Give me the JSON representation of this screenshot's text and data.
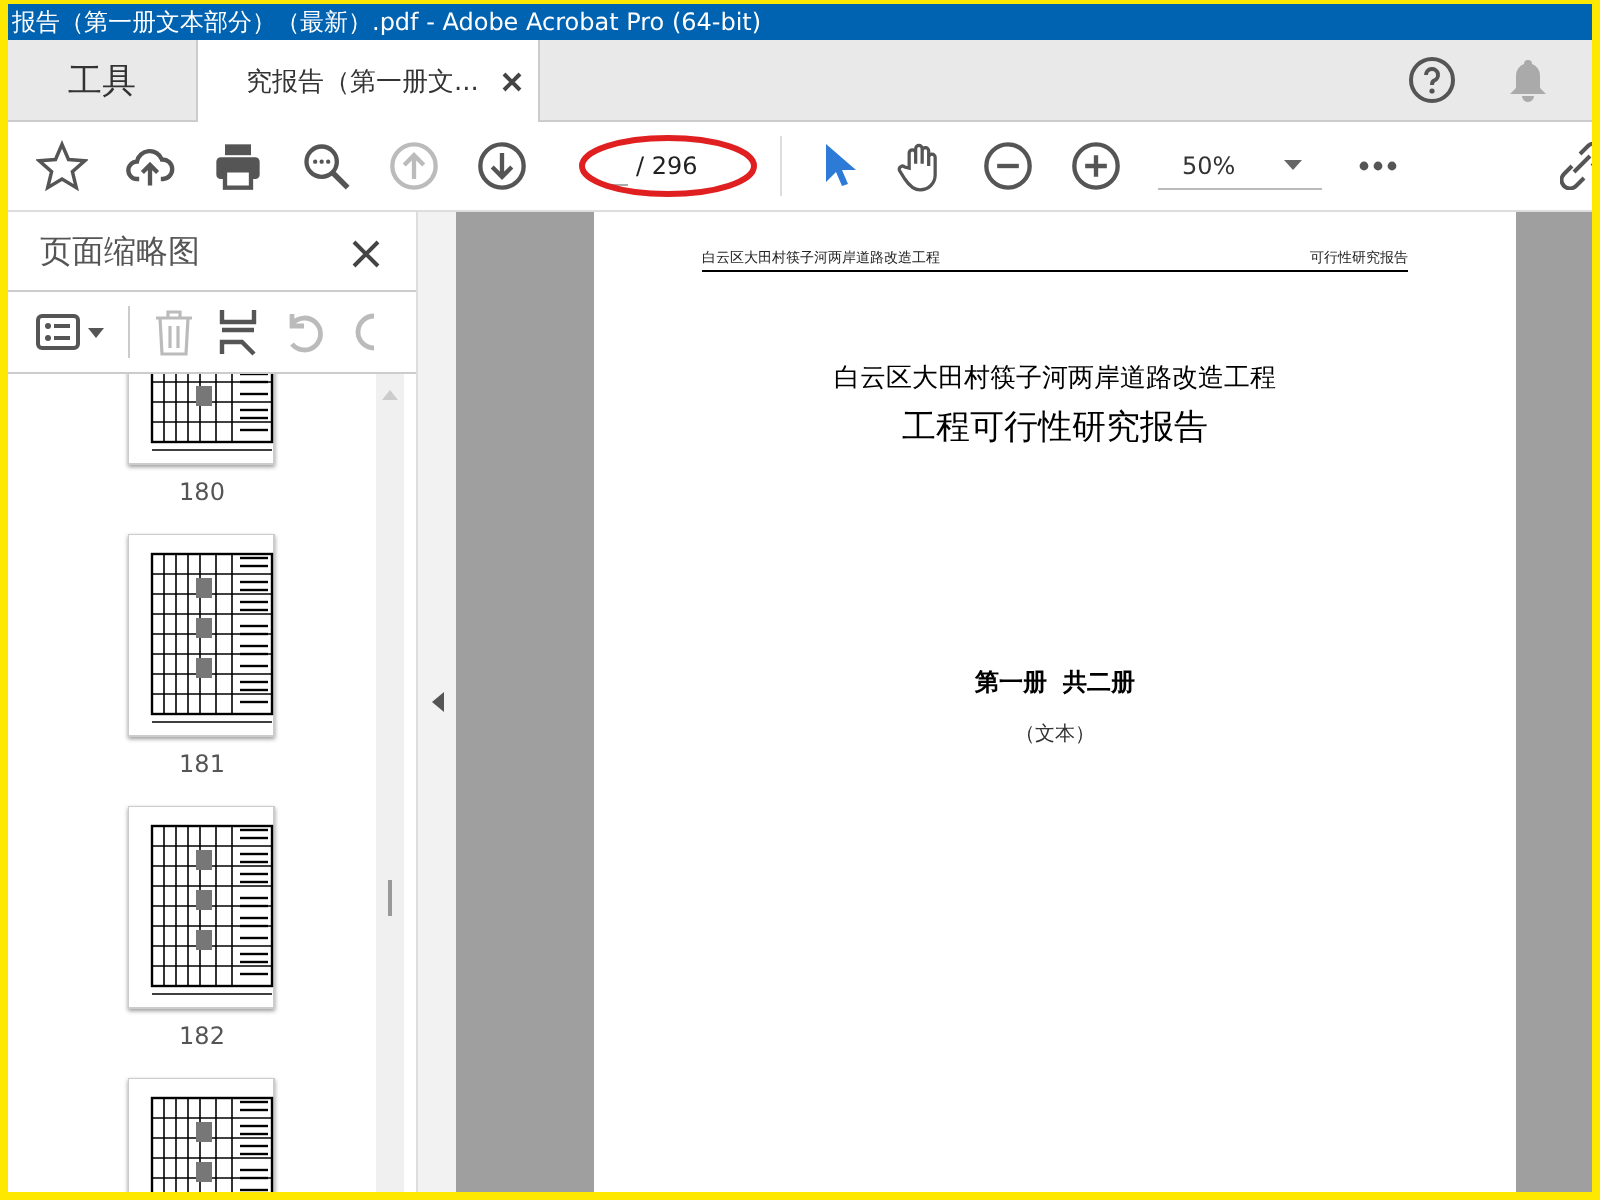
{
  "window": {
    "title": "报告（第一册文本部分）（最新）.pdf - Adobe Acrobat Pro (64-bit)"
  },
  "tabs": [
    {
      "label": "工具",
      "selected": false,
      "closable": false
    },
    {
      "label": "究报告（第一册文...",
      "selected": true,
      "closable": true
    }
  ],
  "toolbar": {
    "tools": [
      {
        "kind": "star",
        "disabled": false
      },
      {
        "kind": "upload",
        "disabled": false
      },
      {
        "kind": "print",
        "disabled": false
      },
      {
        "kind": "search",
        "disabled": false
      },
      {
        "kind": "prev",
        "disabled": true
      },
      {
        "kind": "next",
        "disabled": false
      }
    ],
    "page_total": "/ 296",
    "page_highlighted": true,
    "nav_tools": [
      {
        "kind": "pointer",
        "selected": true
      },
      {
        "kind": "hand",
        "selected": false
      },
      {
        "kind": "zoom-out",
        "selected": false
      },
      {
        "kind": "zoom-in",
        "selected": false
      }
    ],
    "zoom": "50%"
  },
  "sidebar": {
    "title": "页面缩略图",
    "tools": [
      {
        "kind": "options",
        "disabled": false
      },
      {
        "kind": "trash",
        "disabled": true
      },
      {
        "kind": "insert",
        "disabled": false
      },
      {
        "kind": "undo",
        "disabled": true
      },
      {
        "kind": "redo",
        "disabled": true
      }
    ],
    "thumbnails": [
      "180",
      "181",
      "182"
    ],
    "more_below": true
  },
  "document": {
    "header_left": "白云区大田村筷子河两岸道路改造工程",
    "header_right": "可行性研究报告",
    "title_line1": "白云区大田村筷子河两岸道路改造工程",
    "title_line2": "工程可行性研究报告",
    "volume": "第一册  共二册",
    "subtitle": "（文本）"
  }
}
